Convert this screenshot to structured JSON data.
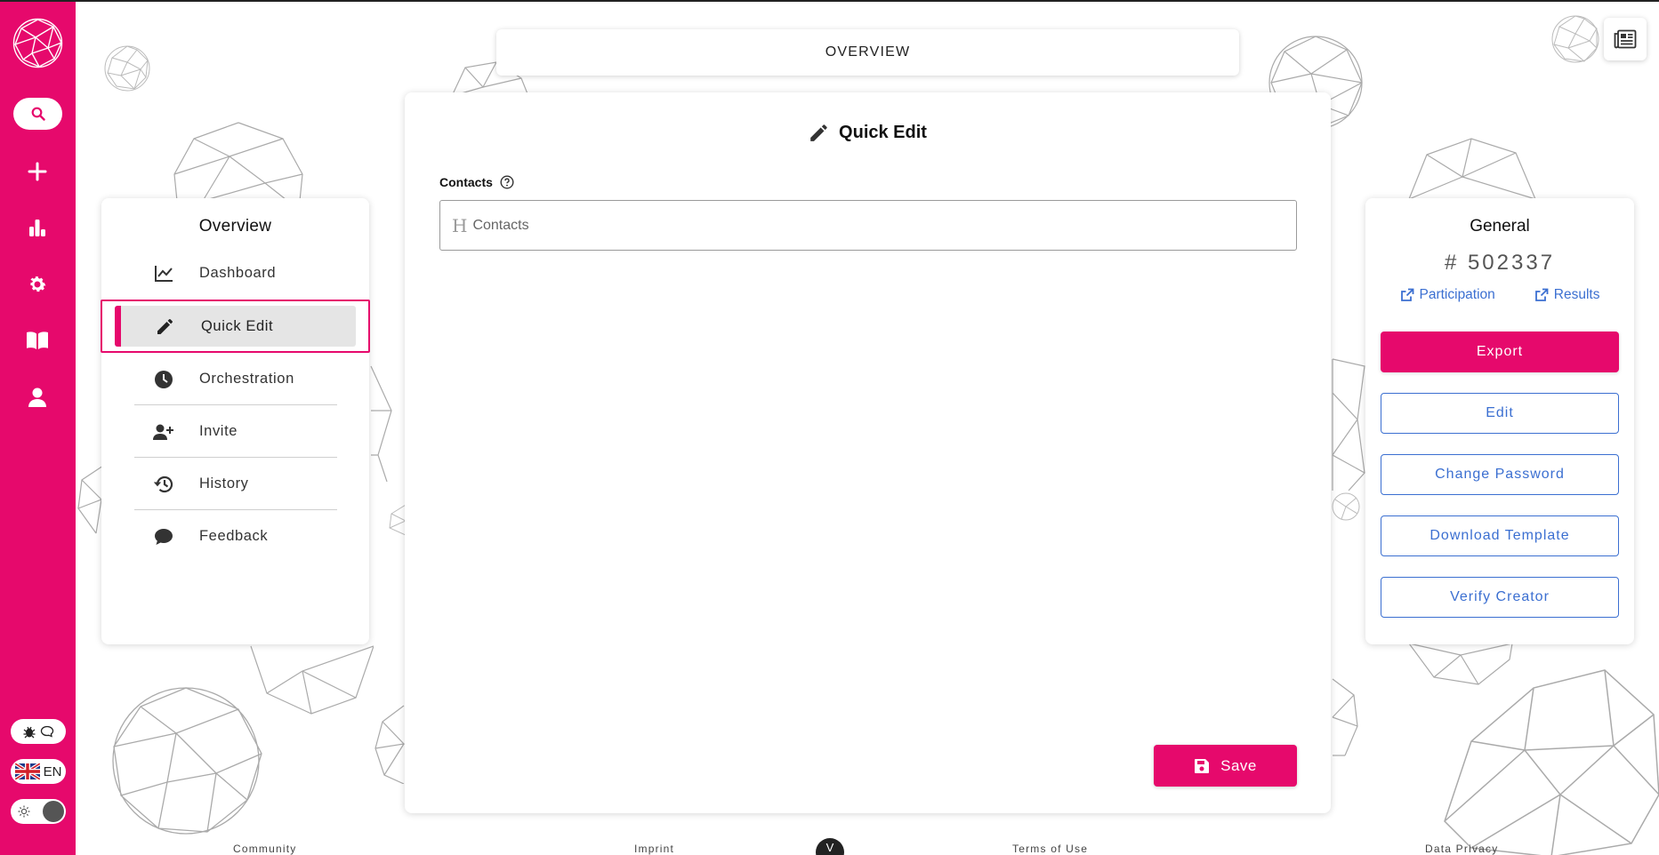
{
  "top_bar": {
    "title": "OVERVIEW"
  },
  "left_nav": {
    "title": "Overview",
    "items": [
      {
        "label": "Dashboard",
        "icon": "chart-line-icon"
      },
      {
        "label": "Quick Edit",
        "icon": "pencil-icon",
        "active": true
      },
      {
        "label": "Orchestration",
        "icon": "clock-icon"
      },
      {
        "label": "Invite",
        "icon": "user-plus-icon"
      },
      {
        "label": "History",
        "icon": "history-icon"
      },
      {
        "label": "Feedback",
        "icon": "comment-icon"
      }
    ]
  },
  "main": {
    "title": "Quick Edit",
    "field": {
      "label": "Contacts",
      "placeholder": "Contacts",
      "value": ""
    },
    "save_label": "Save"
  },
  "general": {
    "title": "General",
    "id": "# 502337",
    "links": [
      {
        "label": "Participation",
        "icon": "external-link-icon"
      },
      {
        "label": "Results",
        "icon": "external-link-icon"
      }
    ],
    "buttons": {
      "export": "Export",
      "edit": "Edit",
      "change_password": "Change Password",
      "download_template": "Download Template",
      "verify_creator": "Verify Creator"
    }
  },
  "rail": {
    "language": "EN"
  },
  "footer": {
    "community": "Community",
    "imprint": "Imprint",
    "circle": "V",
    "terms": "Terms of Use",
    "privacy": "Data Privacy"
  },
  "colors": {
    "accent": "#e6096c",
    "link": "#3b6fd1"
  }
}
